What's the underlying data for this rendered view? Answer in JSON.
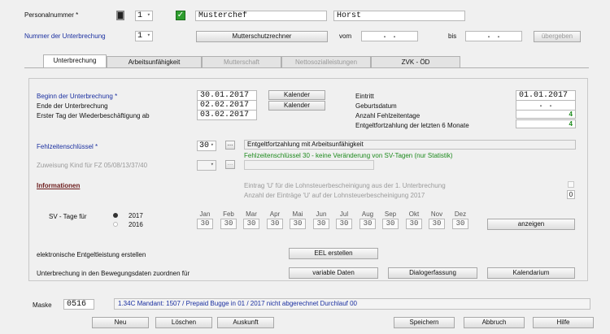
{
  "header": {
    "personalnummer_label": "Personalnummer *",
    "personalnummer_value": "1",
    "lastname": "Musterchef",
    "firstname": "Horst",
    "unterbrechung_label": "Nummer der Unterbrechung",
    "unterbrechung_value": "1",
    "mutterschutz_button": "Mutterschutzrechner",
    "vom_label": "vom",
    "vom_value": ". .",
    "bis_label": "bis",
    "bis_value": ". .",
    "uebergeben_button": "übergeben"
  },
  "tabs": [
    {
      "label": "Unterbrechung"
    },
    {
      "label": "Arbeitsunfähigkeit"
    },
    {
      "label": "Mutterschaft"
    },
    {
      "label": "Nettosozialleistungen"
    },
    {
      "label": "ZVK - ÖD"
    }
  ],
  "form": {
    "beginn_label": "Beginn der Unterbrechung *",
    "beginn_value": "30.01.2017",
    "ende_label": "Ende der Unterbrechung",
    "ende_value": "02.02.2017",
    "erster_tag_label": "Erster Tag der Wiederbeschäftigung ab",
    "erster_tag_value": "03.02.2017",
    "kalender_label": "Kalender",
    "eintritt_label": "Eintritt",
    "eintritt_value": "01.01.2017",
    "geburtsdatum_label": "Geburtsdatum",
    "geburtsdatum_value": ". .",
    "fehlzeitentage_label": "Anzahl Fehlzeitentage",
    "fehlzeitentage_value": "4",
    "entgeltfortzahlung_label": "Entgeltfortzahlung der letzten 6 Monate",
    "entgeltfortzahlung_value": "4",
    "schluessel_label": "Fehlzeitenschlüssel *",
    "schluessel_value": "30",
    "schluessel_dots": "...",
    "schluessel_desc": "Entgeltfortzahlung mit Arbeitsunfähigkeit",
    "schluessel_info": "Fehlzeitenschlüssel 30 - keine Veränderung von SV-Tagen (nur Statistik)",
    "zuweisung_label": "Zuweisung Kind für FZ 05/08/13/37/40",
    "zuweisung_dots": "...",
    "informationen_label": "Informationen",
    "info_line1": "Eintrag 'U' für die Lohnsteuerbescheinigung aus der  1. Unterbrechung",
    "info_line2": "Anzahl der Einträge 'U' auf der Lohnsteuerbescheinigung 2017",
    "info_count": "0",
    "sv_label": "SV - Tage für",
    "year1": "2017",
    "year2": "2016",
    "months": [
      "Jan",
      "Feb",
      "Mar",
      "Apr",
      "Mai",
      "Jun",
      "Jul",
      "Aug",
      "Sep",
      "Okt",
      "Nov",
      "Dez"
    ],
    "month_values": [
      "30",
      "30",
      "30",
      "30",
      "30",
      "30",
      "30",
      "30",
      "30",
      "30",
      "30",
      "30"
    ],
    "anzeigen_button": "anzeigen",
    "eel_label": "elektronische Entgeltleistung erstellen",
    "eel_button": "EEL erstellen",
    "bewegung_label": "Unterbrechung in den Bewegungsdaten zuordnen für",
    "variable_button": "variable Daten",
    "dialog_button": "Dialogerfassung",
    "kalendarium_button": "Kalendarium"
  },
  "footer": {
    "maske_label": "Maske",
    "maske_value": "0516",
    "status_text": "1.34C Mandant: 1507 / Prepaid Bugge in 01 / 2017 nicht abgerechnet  Durchlauf 00",
    "buttons": [
      "Neu",
      "Löschen",
      "Auskunft",
      "Speichern",
      "Abbruch",
      "Hilfe"
    ]
  }
}
